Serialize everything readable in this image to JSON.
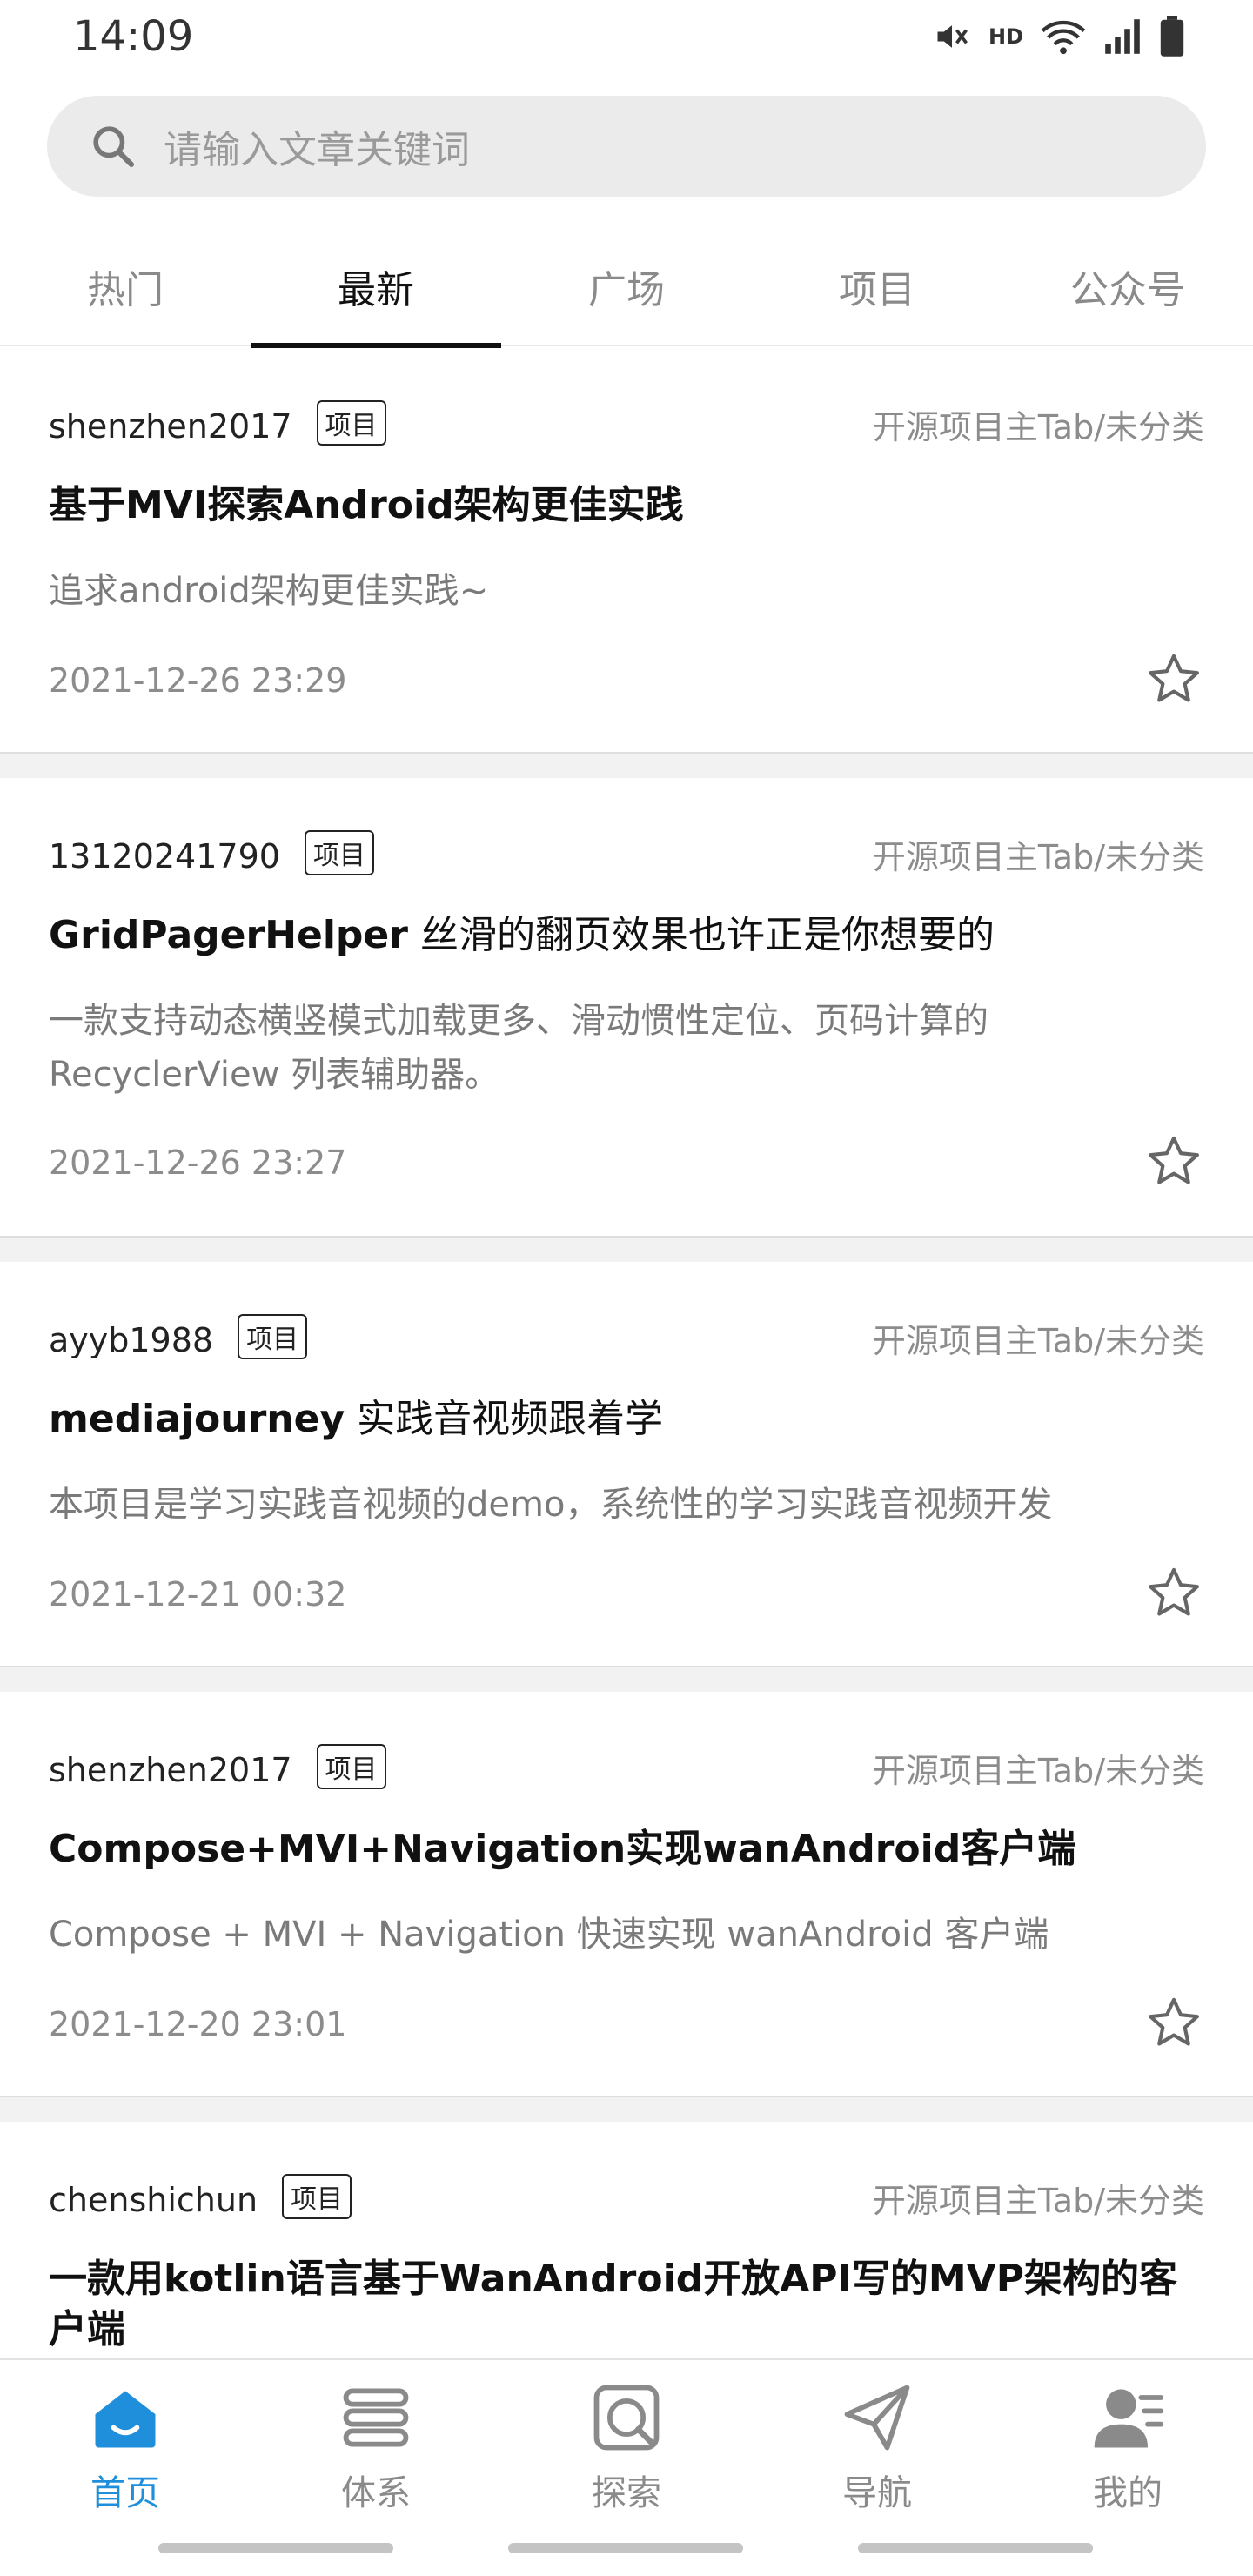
{
  "status": {
    "time": "14:09",
    "network": "HD"
  },
  "search": {
    "placeholder": "请输入文章关键词"
  },
  "tabs": [
    {
      "label": "热门",
      "active": false
    },
    {
      "label": "最新",
      "active": true
    },
    {
      "label": "广场",
      "active": false
    },
    {
      "label": "项目",
      "active": false
    },
    {
      "label": "公众号",
      "active": false
    }
  ],
  "articles": [
    {
      "author": "shenzhen2017",
      "tag": "项目",
      "category": "开源项目主Tab/未分类",
      "title_bold": "基于MVI探索Android架构更佳实践",
      "title_plain": "",
      "desc": "追求android架构更佳实践~",
      "date": "2021-12-26 23:29"
    },
    {
      "author": "13120241790",
      "tag": "项目",
      "category": "开源项目主Tab/未分类",
      "title_bold": "GridPagerHelper",
      "title_plain": " 丝滑的翻页效果也许正是你想要的",
      "desc": "一款支持动态横竖模式加载更多、滑动惯性定位、页码计算的 RecyclerView 列表辅助器。",
      "date": "2021-12-26 23:27"
    },
    {
      "author": "ayyb1988",
      "tag": "项目",
      "category": "开源项目主Tab/未分类",
      "title_bold": "mediajourney",
      "title_plain": " 实践音视频跟着学",
      "desc": "本项目是学习实践音视频的demo，系统性的学习实践音视频开发",
      "date": "2021-12-21 00:32"
    },
    {
      "author": "shenzhen2017",
      "tag": "项目",
      "category": "开源项目主Tab/未分类",
      "title_bold": "Compose+MVI+Navigation实现wanAndroid客户端",
      "title_plain": "",
      "desc": "Compose + MVI + Navigation 快速实现 wanAndroid 客户端",
      "date": "2021-12-20 23:01"
    },
    {
      "author": "chenshichun",
      "tag": "项目",
      "category": "开源项目主Tab/未分类",
      "title_bold": "一款用kotlin语言基于WanAndroid开放API写的MVP架构的客户端",
      "title_plain": "",
      "desc": "",
      "date": ""
    }
  ],
  "bottom_nav": [
    {
      "label": "首页",
      "icon": "home-icon",
      "active": true
    },
    {
      "label": "体系",
      "icon": "layers-icon",
      "active": false
    },
    {
      "label": "探索",
      "icon": "explore-icon",
      "active": false
    },
    {
      "label": "导航",
      "icon": "send-icon",
      "active": false
    },
    {
      "label": "我的",
      "icon": "user-icon",
      "active": false
    }
  ],
  "colors": {
    "accent": "#1f8fdc",
    "inactive": "#8a8a8a",
    "background": "#f2f2f2"
  }
}
